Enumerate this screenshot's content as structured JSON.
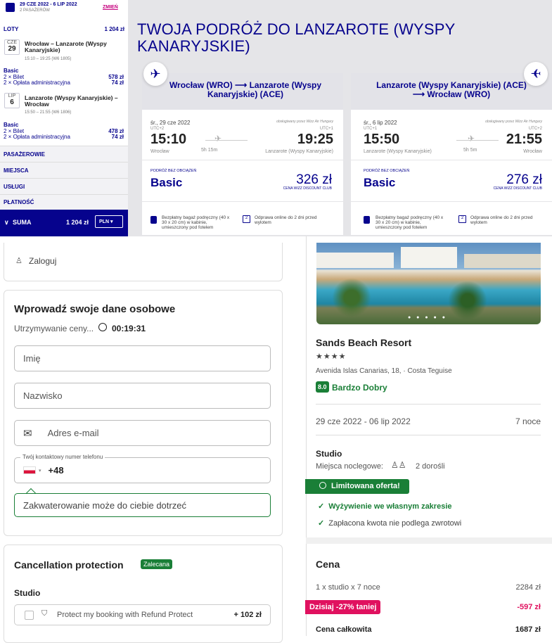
{
  "sidebar": {
    "dates": "29 CZE 2022 - 6 LIP 2022",
    "passengers": "2 PASAŻERÓW",
    "change": "ZMIEŃ",
    "flights_label": "LOTY",
    "flights_total": "1 204 zł",
    "outbound": {
      "month": "CZE",
      "day": "29",
      "route": "Wrocław – Lanzarote (Wyspy Kanaryjskie)",
      "time": "15:10 – 19:25 (W6 1805)",
      "fare": "Basic",
      "ticket": "2 × Bilet",
      "ticket_price": "578 zł",
      "fee": "2 × Opłata administracyjna",
      "fee_price": "74 zł"
    },
    "inbound": {
      "month": "LIP",
      "day": "6",
      "route": "Lanzarote (Wyspy Kanaryjskie) – Wrocław",
      "time": "15:50 – 21:55 (W6 1806)",
      "fare": "Basic",
      "ticket": "2 × Bilet",
      "ticket_price": "478 zł",
      "fee": "2 × Opłata administracyjna",
      "fee_price": "74 zł"
    },
    "sections": [
      "PASAŻEROWIE",
      "MIEJSCA",
      "USŁUGI",
      "PŁATNOŚĆ"
    ],
    "sum_label": "SUMA",
    "sum_value": "1 204 zł",
    "currency": "PLN"
  },
  "main": {
    "title": "TWOJA PODRÓŻ DO LANZAROTE (WYSPY KANARYJSKIE)",
    "cards": [
      {
        "route": "Wrocław (WRO) ⟶ Lanzarote (Wyspy Kanaryjskie) (ACE)",
        "date": "śr., 29 cze 2022",
        "operator": "obsługiwany przez Wizz Air Hungary",
        "tz_dep": "UTC+2",
        "tz_arr": "UTC+1",
        "dep": "15:10",
        "arr": "19:25",
        "duration": "5h 15m",
        "from": "Wrocław",
        "to": "Lanzarote (Wyspy Kanaryjskie)",
        "fare_label": "PODRÓŻ BEZ OBCIĄŻEŃ",
        "fare": "Basic",
        "price": "326 zł",
        "club": "CENA WIZZ DISCOUNT CLUB",
        "bag": "Bezpłatny bagaż podręczny (40 x 30 x 20 cm) w kabinie, umieszczony pod fotelem",
        "checkin": "Odprawa online do 2 dni przed wylotem"
      },
      {
        "route": "Lanzarote (Wyspy Kanaryjskie) (ACE) ⟶ Wrocław (WRO)",
        "date": "śr., 6 lip 2022",
        "operator": "obsługiwany przez Wizz Air Hungary",
        "tz_dep": "UTC+1",
        "tz_arr": "UTC+2",
        "dep": "15:50",
        "arr": "21:55",
        "duration": "5h 5m",
        "from": "Lanzarote (Wyspy Kanaryjskie)",
        "to": "Wrocław",
        "fare_label": "PODRÓŻ BEZ OBCIĄŻEŃ",
        "fare": "Basic",
        "price": "276 zł",
        "club": "CENA WIZZ DISCOUNT CLUB",
        "bag": "Bezpłatny bagaż podręczny (40 x 30 x 20 cm) w kabinie, umieszczony pod fotelem",
        "checkin": "Odprawa online do 2 dni przed wylotem"
      }
    ]
  },
  "booking": {
    "login": "Zaloguj",
    "personal_title": "Wprowadź swoje dane osobowe",
    "hold_text": "Utrzymywanie ceny...",
    "timer": "00:19:31",
    "first_name_placeholder": "Imię",
    "last_name_placeholder": "Nazwisko",
    "email_placeholder": "Adres e-mail",
    "phone_label": "Twój kontaktowy numer telefonu",
    "phone_prefix": "+48",
    "tooltip": "Zakwaterowanie może do ciebie dotrzeć",
    "cancel_title": "Cancellation protection",
    "cancel_badge": "Zalecana",
    "cancel_room": "Studio",
    "refund_text": "Protect my booking with Refund Protect",
    "refund_price": "+ 102 zł"
  },
  "hotel": {
    "name": "Sands Beach Resort",
    "stars": "★★★★",
    "address": "Avenida Islas Canarias, 18, · Costa Teguise",
    "score": "8.0",
    "rating": "Bardzo Dobry",
    "dates": "29 cze 2022 - 06 lip 2022",
    "nights": "7 noce",
    "room": "Studio",
    "sleeps_label": "Miejsca noclegowe:",
    "sleeps": "2 dorośli",
    "offer": "Limitowana oferta!",
    "board": "Wyżywienie we własnym zakresie",
    "nonrefund": "Zapłacona kwota nie podlega zwrotowi",
    "price_title": "Cena",
    "line1": "1 x studio x 7 noce",
    "line1_value": "2284 zł",
    "discount": "Dzisiaj -27% taniej",
    "discount_value": "-597 zł",
    "total_label": "Cena całkowita",
    "total_value": "1687 zł"
  },
  "colors": {
    "wizz_blue": "#06038d",
    "green": "#1a7f37",
    "pink": "#e0115f"
  }
}
